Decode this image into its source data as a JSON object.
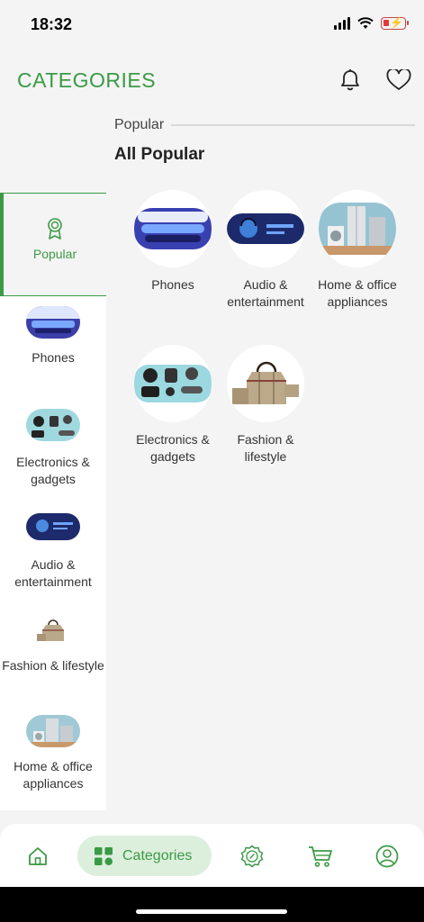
{
  "status_bar": {
    "time": "18:32"
  },
  "header": {
    "title": "CATEGORIES",
    "icons": [
      "bell-icon",
      "heart-icon"
    ]
  },
  "sidebar": {
    "items": [
      {
        "label": "Popular",
        "icon": "badge-icon",
        "active": true
      },
      {
        "label": "Phones",
        "icon": "phones-thumb"
      },
      {
        "label": "Electronics & gadgets",
        "icon": "electronics-thumb"
      },
      {
        "label": "Audio & entertainment",
        "icon": "audio-thumb"
      },
      {
        "label": "Fashion & lifestyle",
        "icon": "fashion-thumb"
      },
      {
        "label": "Home & office appliances",
        "icon": "home-office-thumb"
      }
    ]
  },
  "content": {
    "section_label": "Popular",
    "heading": "All Popular",
    "categories": [
      {
        "label": "Phones",
        "image": "phones-image"
      },
      {
        "label": "Audio & entertainment",
        "image": "audio-image"
      },
      {
        "label": "Home & office appliances",
        "image": "appliances-image"
      },
      {
        "label": "Electronics & gadgets",
        "image": "electronics-image"
      },
      {
        "label": "Fashion & lifestyle",
        "image": "fashion-image"
      }
    ]
  },
  "bottom_nav": {
    "items": [
      {
        "name": "home",
        "icon": "home-icon"
      },
      {
        "name": "categories",
        "icon": "grid-icon",
        "label": "Categories",
        "active": true
      },
      {
        "name": "deals",
        "icon": "discount-badge-icon"
      },
      {
        "name": "cart",
        "icon": "cart-icon"
      },
      {
        "name": "account",
        "icon": "user-icon"
      }
    ]
  },
  "colors": {
    "accent": "#3a9a45",
    "accent_bg": "#dcefdc",
    "page_bg": "#f4f4f4"
  }
}
